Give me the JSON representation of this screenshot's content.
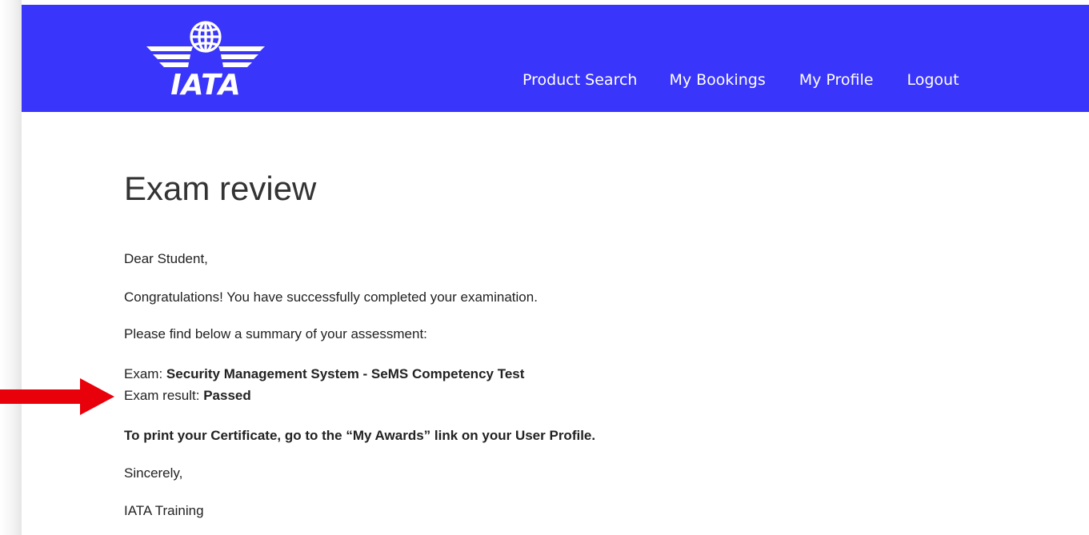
{
  "header": {
    "logo_text": "IATA",
    "brand_color": "#3a35fb",
    "nav": [
      {
        "label": "Product Search"
      },
      {
        "label": "My Bookings"
      },
      {
        "label": "My Profile"
      },
      {
        "label": "Logout"
      }
    ]
  },
  "main": {
    "title": "Exam review",
    "greeting": "Dear Student,",
    "congrats": "Congratulations!  You have successfully completed your examination.",
    "summary_intro": "Please find below a summary of your assessment:",
    "exam_label": "Exam: ",
    "exam_name": "Security Management System - SeMS Competency Test",
    "result_label": "Exam result: ",
    "result_value": "Passed",
    "print_notice": "To print your Certificate, go to the “My Awards” link on your User Profile.",
    "closing": "Sincerely,",
    "signature": "IATA Training"
  },
  "annotation": {
    "arrow_color": "#e8000b",
    "icon": "right-arrow-icon"
  }
}
